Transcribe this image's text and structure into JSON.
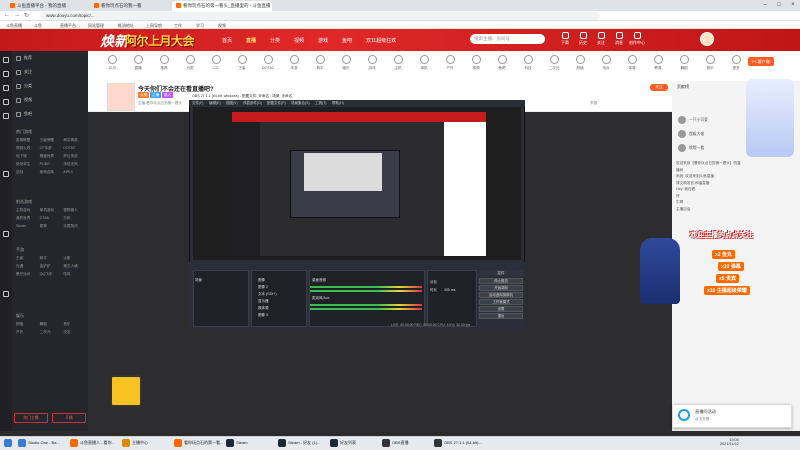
{
  "browser": {
    "tabs": [
      {
        "label": "斗鱼直播平台 - 我的直播",
        "color": "#ff6a00"
      },
      {
        "label": "看你玩点石的我一看",
        "color": "#ff6a00"
      },
      {
        "label": "看你玩点石的第一看头_直播里的 - 斗鱼直播",
        "color": "#ff6a00",
        "active": true
      }
    ],
    "url": "www.douyu.com/topic/...",
    "bookmarks": [
      "斗鱼直播",
      "斗鱼",
      "直播平台",
      "网站管理",
      "推流地址",
      "上网导航",
      "工作",
      "学习",
      "视频"
    ]
  },
  "banner": {
    "logo": "焕新",
    "headline": "阿尔上月大会",
    "nav": [
      "首页",
      "直播",
      "分类",
      "视频",
      "游戏",
      "鱼吧",
      "双11超级狂欢"
    ],
    "nav_selected": 1,
    "search_placeholder": "搜索主播、房间号",
    "actions": [
      "下载",
      "历史",
      "关注",
      "消息",
      "创作中心"
    ]
  },
  "sidebar": {
    "primary": [
      "推荐",
      "关注",
      "分类",
      "视频",
      "鱼吧"
    ],
    "section_heads": [
      "热门游戏",
      "射击游戏",
      "手游",
      "新游",
      "娱乐"
    ],
    "items_a": [
      "英雄联盟",
      "王者荣耀",
      "和平精英",
      "穿越火线",
      "CF手游",
      "DOTA2",
      "地下城",
      "魔兽世界",
      "炉石传说",
      "绝地求生",
      "PUBG",
      "永劫无间",
      "逆战",
      "使命召唤",
      "APEX"
    ],
    "items_b": [
      "主机游戏",
      "单机游戏",
      "怪物猎人",
      "我的世界",
      "GTA5",
      "方舟",
      "Steam",
      "原神",
      "无畏契约"
    ],
    "items_c": [
      "王者",
      "和平",
      "火影",
      "光遇",
      "金铲铲",
      "第五人格",
      "蛋仔派对",
      "QQ飞车",
      "吃鸡"
    ],
    "items_d": [
      "颜值",
      "舞蹈",
      "音乐",
      "户外",
      "二次元",
      "交友"
    ],
    "dock_buttons": [
      "热门主播",
      "开播"
    ]
  },
  "categories": [
    {
      "label": "12月"
    },
    {
      "label": "直播"
    },
    {
      "label": "推荐"
    },
    {
      "label": "分类"
    },
    {
      "label": "LOL"
    },
    {
      "label": "王者"
    },
    {
      "label": "DOTA2"
    },
    {
      "label": "手游"
    },
    {
      "label": "和平"
    },
    {
      "label": "娱乐"
    },
    {
      "label": "游戏"
    },
    {
      "label": "主机"
    },
    {
      "label": "单机"
    },
    {
      "label": "户外"
    },
    {
      "label": "视频"
    },
    {
      "label": "鱼吧"
    },
    {
      "label": "科技"
    },
    {
      "label": "二次元"
    },
    {
      "label": "颜值"
    },
    {
      "label": "电台"
    },
    {
      "label": "体育"
    },
    {
      "label": "教育"
    },
    {
      "label": "舞蹈"
    },
    {
      "label": "音乐"
    },
    {
      "label": "更多"
    }
  ],
  "pc_button": "PC客户端",
  "room": {
    "title": "今天你们不会还在看直播吧?",
    "tags": [
      "大神",
      "主播",
      "新人"
    ],
    "meta": [
      "主播:看你玩点石的第一看头",
      "房间号:",
      "分类:单机",
      "热度:",
      "举报"
    ],
    "follow": "关注",
    "host_name": "看你玩点石"
  },
  "obs": {
    "title": "OBS 27.1.1 (64-bit, windows) - 配置文件: 未命名 - 场景: 未命名",
    "menu": [
      "文件(F)",
      "编辑(E)",
      "视图(V)",
      "停靠部件(D)",
      "配置文件(P)",
      "场景集合(S)",
      "工具(T)",
      "帮助(H)"
    ],
    "docks": [
      "场景",
      "来源",
      "混音器",
      "转场特效",
      "控件"
    ],
    "scene": "场景",
    "sources": [
      "图像",
      "图像 2",
      "文本 (GDI+)",
      "显示器",
      "媒体源",
      "图像 3"
    ],
    "mixer": [
      "桌面音频",
      "麦克风/Aux"
    ],
    "transition": "淡化",
    "duration_label": "时长",
    "duration": "300 ms",
    "controls": [
      "停止推流",
      "开始录制",
      "启动虚拟摄像机",
      "工作室模式",
      "设置",
      "退出"
    ],
    "status": "LIVE: 00:00:00  REC: 00:00:00  CPU: 4.5%, 30.00 fps"
  },
  "chat": {
    "rank_head": "贡献榜",
    "rank": [
      "一只小可爱",
      "超级大佬",
      "哦哦一看"
    ],
    "messages": [
      "欢迎来到【看你玩点石的第一看头】的直播间",
      "系统: 欢迎来到斗鱼直播",
      "请文明发言,和谐直播",
      "Hey: 我在看",
      "好",
      "牛啊",
      "主播加油"
    ],
    "promo": "欢迎主播的点点关注",
    "perks": [
      "x2 鱼丸",
      "x10 弹幕",
      "x5 贵宾",
      "x10 主播超级荣耀"
    ],
    "notif_title": "直播间活动",
    "notif_sub": "点击查看"
  },
  "taskbar": {
    "items": [
      {
        "label": "Studio One - Ba...",
        "color": "#3b7bd4"
      },
      {
        "label": "斗鱼直播人 - 看你...",
        "color": "#ff6a00"
      },
      {
        "label": "主播中心",
        "color": "#d88a00"
      },
      {
        "label": "看你玩点石的第一看...",
        "color": "#ff6a00"
      },
      {
        "label": "Steam",
        "color": "#1b2838"
      },
      {
        "label": "Steam - 好友 (1)...",
        "color": "#1b2838"
      },
      {
        "label": "好友列表",
        "color": "#1b2838"
      },
      {
        "label": "OBS直播",
        "color": "#333333"
      },
      {
        "label": "OBS 27.1.1 (64-bit)...",
        "color": "#333333"
      }
    ],
    "time": "19:00",
    "date": "2021/11/22"
  }
}
